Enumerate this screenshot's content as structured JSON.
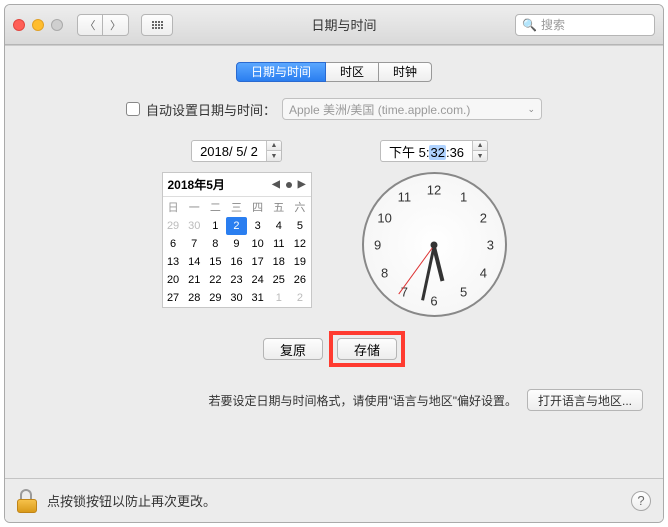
{
  "window": {
    "title": "日期与时间"
  },
  "search": {
    "placeholder": "搜索"
  },
  "tabs": [
    "日期与时间",
    "时区",
    "时钟"
  ],
  "auto": {
    "label": "自动设置日期与时间：",
    "server": "Apple 美洲/美国 (time.apple.com.)"
  },
  "date_field": "2018/ 5/ 2",
  "time_field": {
    "prefix": "下午",
    "h": "5",
    "m": "32",
    "s": "36"
  },
  "calendar": {
    "title": "2018年5月",
    "weekdays": [
      "日",
      "一",
      "二",
      "三",
      "四",
      "五",
      "六"
    ],
    "leading": [
      29,
      30
    ],
    "days": [
      1,
      2,
      3,
      4,
      5,
      6,
      7,
      8,
      9,
      10,
      11,
      12,
      13,
      14,
      15,
      16,
      17,
      18,
      19,
      20,
      21,
      22,
      23,
      24,
      25,
      26,
      27,
      28,
      29,
      30,
      31
    ],
    "trailing": [
      1,
      2
    ],
    "today": 2
  },
  "clock_numbers": {
    "12": "12",
    "1": "1",
    "2": "2",
    "3": "3",
    "4": "4",
    "5": "5",
    "6": "6",
    "7": "7",
    "8": "8",
    "9": "9",
    "10": "10",
    "11": "11"
  },
  "buttons": {
    "revert": "复原",
    "save": "存储",
    "open_region": "打开语言与地区..."
  },
  "hint": "若要设定日期与时间格式，请使用\"语言与地区\"偏好设置。",
  "footer": "点按锁按钮以防止再次更改。"
}
